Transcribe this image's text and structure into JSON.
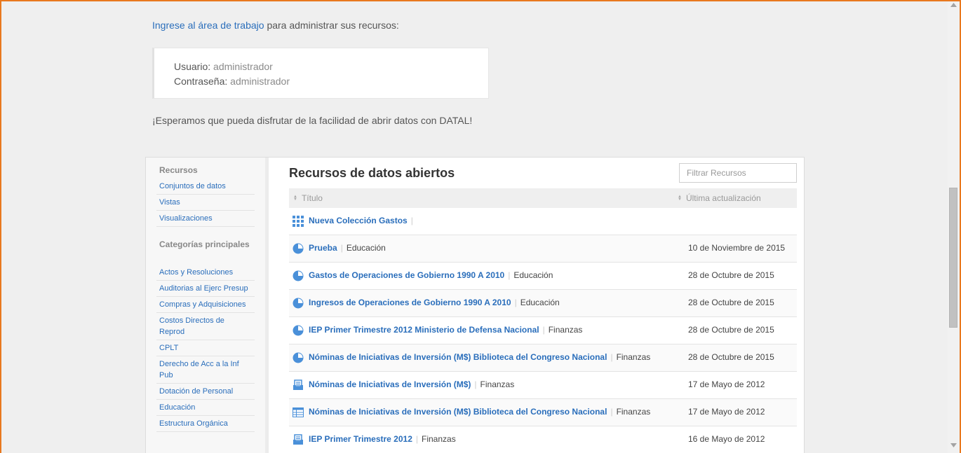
{
  "intro": {
    "link": "Ingrese al área de trabajo",
    "rest": " para administrar sus recursos:"
  },
  "credentials": {
    "user_label": "Usuario:",
    "user_value": "administrador",
    "pass_label": "Contraseña:",
    "pass_value": "administrador"
  },
  "enjoy_text": "¡Esperamos que pueda disfrutar de la facilidad de abrir datos con DATAL!",
  "sidebar": {
    "resources_heading": "Recursos",
    "resources": [
      "Conjuntos de datos",
      "Vistas",
      "Visualizaciones"
    ],
    "categories_heading": "Categorías principales",
    "categories": [
      "Actos y Resoluciones",
      "Auditorias al Ejerc Presup",
      "Compras y Adquisiciones",
      "Costos Directos de Reprod",
      "CPLT",
      "Derecho de Acc a la Inf Pub",
      "Dotación de Personal",
      "Educación",
      "Estructura Orgánica"
    ]
  },
  "main": {
    "title": "Recursos de datos abiertos",
    "filter_placeholder": "Filtrar Recursos",
    "col_title": "Título",
    "col_updated": "Última actualización",
    "rows": [
      {
        "icon": "grid-icon",
        "name": "Nueva Colección Gastos",
        "category": "",
        "date": ""
      },
      {
        "icon": "pie-chart-icon",
        "name": "Prueba",
        "category": "Educación",
        "date": "10 de Noviembre de 2015"
      },
      {
        "icon": "pie-chart-icon",
        "name": "Gastos de Operaciones de Gobierno 1990 A 2010",
        "category": "Educación",
        "date": "28 de Octubre de 2015"
      },
      {
        "icon": "pie-chart-icon",
        "name": "Ingresos de Operaciones de Gobierno 1990 A 2010",
        "category": "Educación",
        "date": "28 de Octubre de 2015"
      },
      {
        "icon": "pie-chart-icon",
        "name": "IEP Primer Trimestre 2012 Ministerio de Defensa Nacional",
        "category": "Finanzas",
        "date": "28 de Octubre de 2015"
      },
      {
        "icon": "pie-chart-icon",
        "name": "Nóminas de Iniciativas de Inversión (M$) Biblioteca del Congreso Nacional",
        "category": "Finanzas",
        "date": "28 de Octubre de 2015"
      },
      {
        "icon": "dataset-tray-icon",
        "name": "Nóminas de Iniciativas de Inversión (M$)",
        "category": "Finanzas",
        "date": "17 de Mayo de 2012"
      },
      {
        "icon": "table-icon",
        "name": "Nóminas de Iniciativas de Inversión (M$) Biblioteca del Congreso Nacional",
        "category": "Finanzas",
        "date": "17 de Mayo de 2012"
      },
      {
        "icon": "dataset-tray-icon",
        "name": "IEP Primer Trimestre 2012",
        "category": "Finanzas",
        "date": "16 de Mayo de 2012"
      }
    ]
  },
  "colors": {
    "link": "#2a6ebb",
    "icon": "#4a90d9",
    "frame": "#e8781e"
  }
}
